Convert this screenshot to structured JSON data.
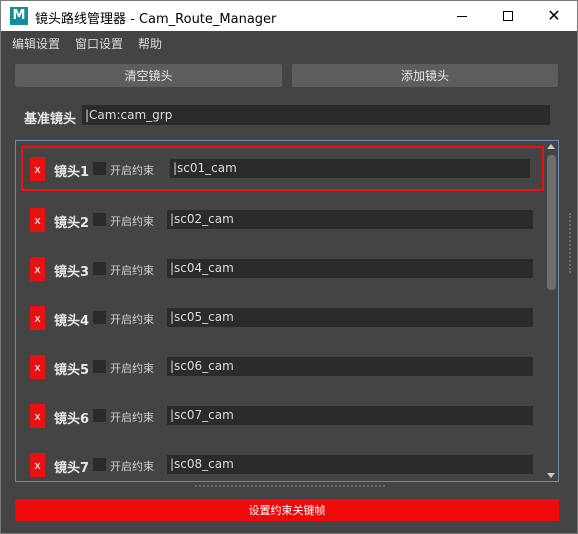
{
  "window": {
    "title": "镜头路线管理器 - Cam_Route_Manager",
    "icon_letter": "M"
  },
  "menu": [
    "编辑设置",
    "窗口设置",
    "帮助"
  ],
  "toolbar": {
    "clear_label": "清空镜头",
    "add_label": "添加镜头"
  },
  "base": {
    "label": "基准镜头",
    "value": "|Cam:cam_grp"
  },
  "cameras": [
    {
      "delete_label": "x",
      "label": "镜头1",
      "constraint_label": "开启约束",
      "constraint_checked": false,
      "value": "|sc01_cam"
    },
    {
      "delete_label": "x",
      "label": "镜头2",
      "constraint_label": "开启约束",
      "constraint_checked": false,
      "value": "|sc02_cam"
    },
    {
      "delete_label": "x",
      "label": "镜头3",
      "constraint_label": "开启约束",
      "constraint_checked": false,
      "value": "|sc04_cam"
    },
    {
      "delete_label": "x",
      "label": "镜头4",
      "constraint_label": "开启约束",
      "constraint_checked": false,
      "value": "|sc05_cam"
    },
    {
      "delete_label": "x",
      "label": "镜头5",
      "constraint_label": "开启约束",
      "constraint_checked": false,
      "value": "|sc06_cam"
    },
    {
      "delete_label": "x",
      "label": "镜头6",
      "constraint_label": "开启约束",
      "constraint_checked": false,
      "value": "|sc07_cam"
    },
    {
      "delete_label": "x",
      "label": "镜头7",
      "constraint_label": "开启约束",
      "constraint_checked": false,
      "value": "|sc08_cam"
    }
  ],
  "footer": {
    "keyframe_label": "设置约束关键帧"
  },
  "colors": {
    "accent_red": "#e81010",
    "panel_bg": "#444444",
    "field_bg": "#2b2b2b"
  }
}
